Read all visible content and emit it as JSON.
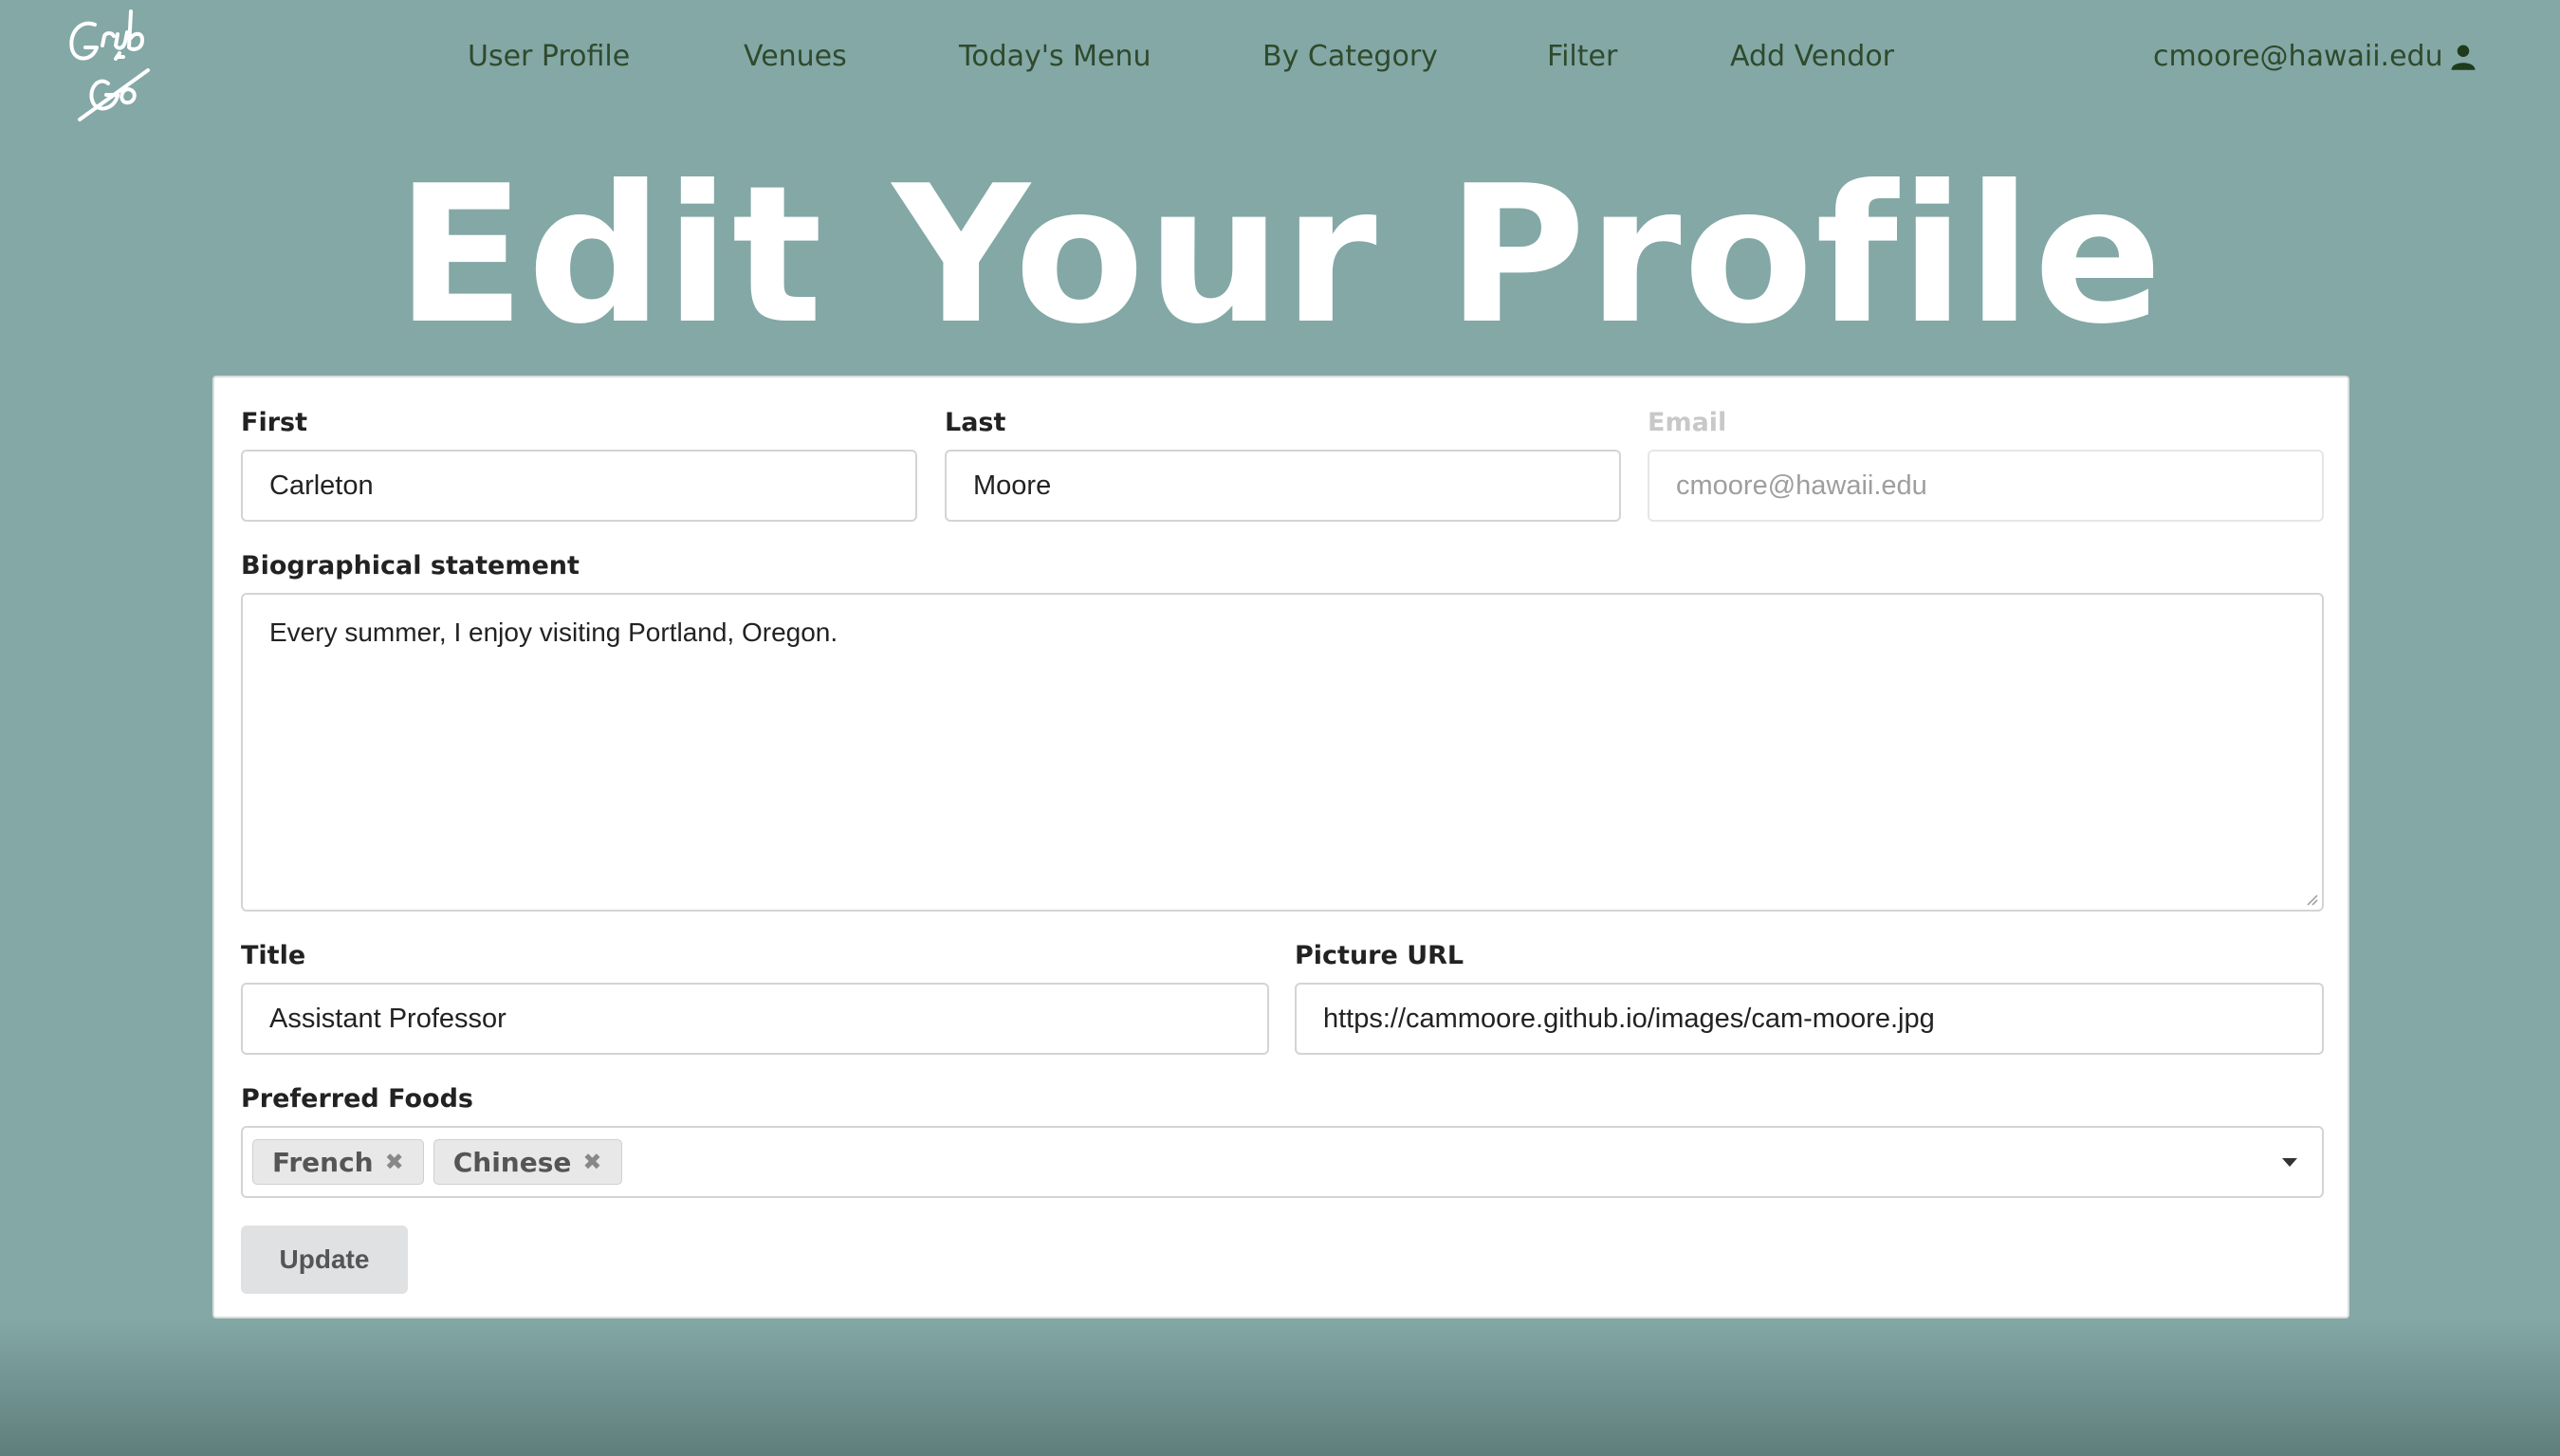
{
  "logo": {
    "alt": "Grub n Go"
  },
  "nav": {
    "items": [
      "User Profile",
      "Venues",
      "Today's Menu",
      "By Category",
      "Filter",
      "Add Vendor"
    ],
    "user_email": "cmoore@hawaii.edu",
    "user_icon": "user-icon"
  },
  "page": {
    "title": "Edit Your Profile"
  },
  "form": {
    "first": {
      "label": "First",
      "value": "Carleton"
    },
    "last": {
      "label": "Last",
      "value": "Moore"
    },
    "email": {
      "label": "Email",
      "value": "cmoore@hawaii.edu",
      "disabled": true
    },
    "bio": {
      "label": "Biographical statement",
      "value": "Every summer, I enjoy visiting Portland, Oregon."
    },
    "title": {
      "label": "Title",
      "value": "Assistant Professor"
    },
    "picture": {
      "label": "Picture URL",
      "value": "https://cammoore.github.io/images/cam-moore.jpg"
    },
    "foods": {
      "label": "Preferred Foods",
      "selected": [
        "French",
        "Chinese"
      ]
    },
    "submit_label": "Update"
  },
  "colors": {
    "background": "#83a8a6",
    "nav_text": "#2f4a2c",
    "title_text": "#ffffff"
  }
}
